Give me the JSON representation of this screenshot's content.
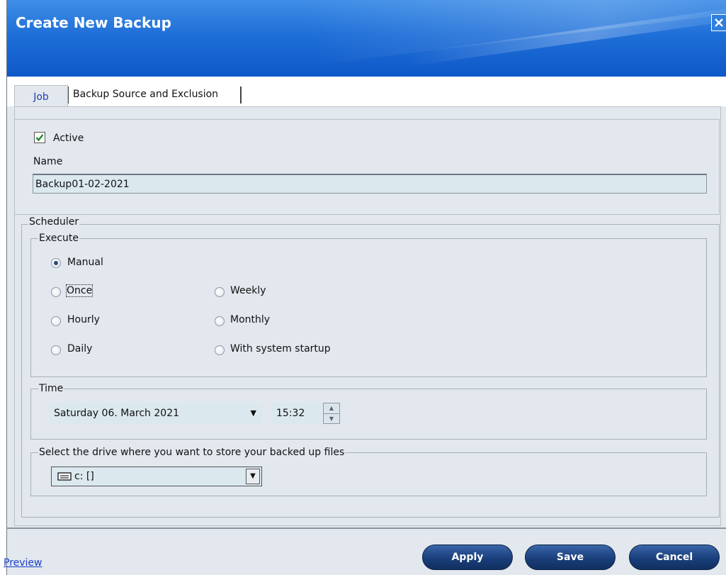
{
  "window": {
    "title": "Create New Backup"
  },
  "tabs": [
    {
      "label": "Job"
    },
    {
      "label": "Backup Source and Exclusion"
    }
  ],
  "job": {
    "active_label": "Active",
    "active_checked": true,
    "name_label": "Name",
    "name_value": "Backup01-02-2021"
  },
  "scheduler": {
    "legend": "Scheduler",
    "execute": {
      "legend": "Execute",
      "options": [
        "Manual",
        "Once",
        "Weekly",
        "Hourly",
        "Monthly",
        "Daily",
        "With system startup"
      ],
      "selected": "Manual"
    },
    "time": {
      "legend": "Time",
      "date": "Saturday 06. March 2021",
      "time": "15:32"
    },
    "drive": {
      "legend": "Select the drive where you want to store your backed up files",
      "value": "c: []"
    }
  },
  "footer": {
    "preview_label": "Preview",
    "apply_label": "Apply",
    "save_label": "Save",
    "cancel_label": "Cancel"
  },
  "colors": {
    "titlebar": "#1f6fd8",
    "panel_bg": "#e3e8ee",
    "button_bg": "#1a3f7c",
    "link": "#1a3fc8"
  }
}
